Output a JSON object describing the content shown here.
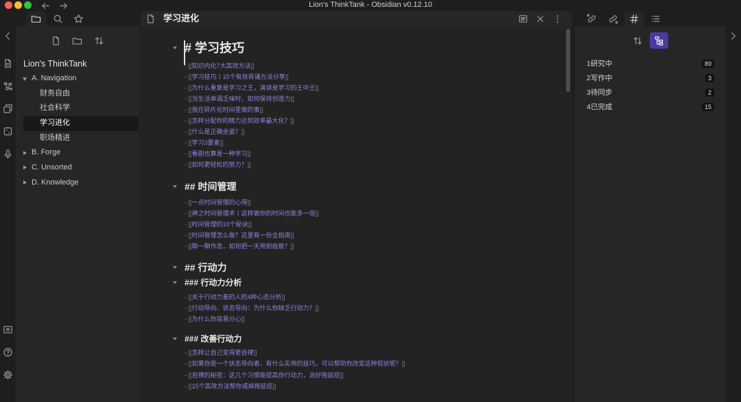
{
  "window": {
    "title": "Lion's ThinkTank - Obsidian v0.12.10",
    "traffic_lights": [
      "#ff5f57",
      "#febc2e",
      "#28c840"
    ],
    "nav_icons": [
      "arrow-left-icon",
      "arrow-right-icon"
    ]
  },
  "colors": {
    "accent": "#7f6df2",
    "link": "#8b87e0",
    "active_toggle": "#4a3b9f"
  },
  "ribbon": {
    "top_icons": [
      "chevron-left-icon",
      "quick-switcher-icon",
      "graph-view-icon",
      "templates-icon",
      "random-note-icon",
      "microphone-icon"
    ],
    "bottom_icons": [
      "vault-icon",
      "help-icon",
      "settings-icon"
    ]
  },
  "left_sidebar": {
    "tabs": [
      {
        "icon": "folder-icon",
        "active": true
      },
      {
        "icon": "search-icon",
        "active": false
      },
      {
        "icon": "star-icon",
        "active": false
      }
    ],
    "toolbar": [
      "new-note-icon",
      "new-folder-icon",
      "sort-icon"
    ],
    "file_tree": {
      "vault_name": "Lion's ThinkTank",
      "active_file": "学习进化",
      "folders": [
        {
          "name": "A. Navigation",
          "expanded": true,
          "files": [
            "财务自由",
            "社会科学",
            "学习进化",
            "职场精进"
          ]
        },
        {
          "name": "B. Forge",
          "expanded": false
        },
        {
          "name": "C. Unsorted",
          "expanded": false
        },
        {
          "name": "D. Knowledge",
          "expanded": false
        }
      ]
    }
  },
  "editor": {
    "title": "学习进化",
    "header_icons": [
      "file-icon",
      "preview-icon",
      "close-icon",
      "more-icon"
    ],
    "syntax": {
      "bullet": "-",
      "link_open": "[[",
      "link_close": "]]"
    },
    "sections": [
      {
        "heading": "# 学习技巧",
        "level": 1,
        "links": [
          "知识内化7大高效方法",
          "学习技巧丨15个有效背诵方法分享",
          "为什么重复是学习之王，演讲是学习的王中王",
          "当生活单调乏味时，如何保持创造力",
          "我在碎片化时间里做的事",
          "怎样分配你的精力达到效率最大化？",
          "什么是正确坐姿？",
          "学习3要素",
          "看剧也算是一种学习",
          "如何更轻松的努力？"
        ]
      },
      {
        "heading": "## 时间管理",
        "level": 2,
        "links": [
          "一点时间管理的心得",
          "神之时间管理术丨这样做你的时间也能多一倍",
          "时间管理的10个秘诀",
          "时间管理怎么做？这里有一份全指南",
          "聊一聊作息，如何把一天用到极致？"
        ]
      },
      {
        "heading": "## 行动力",
        "level": 2,
        "links": []
      },
      {
        "heading": "### 行动力分析",
        "level": 3,
        "links": [
          "关于行动力差的人的4种心态分析",
          "行动导向、状态导向：为什么你缺乏行动力？",
          "为什么你容易分心"
        ]
      },
      {
        "heading": "### 改善行动力",
        "level": 3,
        "links": [
          "怎样让自己变得更自律",
          "如果你是一个状态导向者，有什么实用的技巧，可以帮助你改变这种现状呢？",
          "自律的秘密：这几个习惯能提高你行动力，治好拖延症",
          "15个高效方法帮你戒掉拖延症"
        ]
      }
    ]
  },
  "right_sidebar": {
    "tabs": [
      {
        "icon": "backlinks-icon",
        "active": false
      },
      {
        "icon": "outgoing-links-icon",
        "active": false
      },
      {
        "icon": "tag-icon",
        "active": true
      },
      {
        "icon": "outline-icon",
        "active": false
      }
    ],
    "tag_pane": {
      "toolbar": [
        "sort-icon",
        "tag-tree-icon"
      ],
      "tags": [
        {
          "name": "1研究中",
          "count": 89
        },
        {
          "name": "2写作中",
          "count": 3
        },
        {
          "name": "3待同步",
          "count": 2
        },
        {
          "name": "4已完成",
          "count": 15
        }
      ]
    },
    "collapse_icon": "chevron-right-icon"
  }
}
